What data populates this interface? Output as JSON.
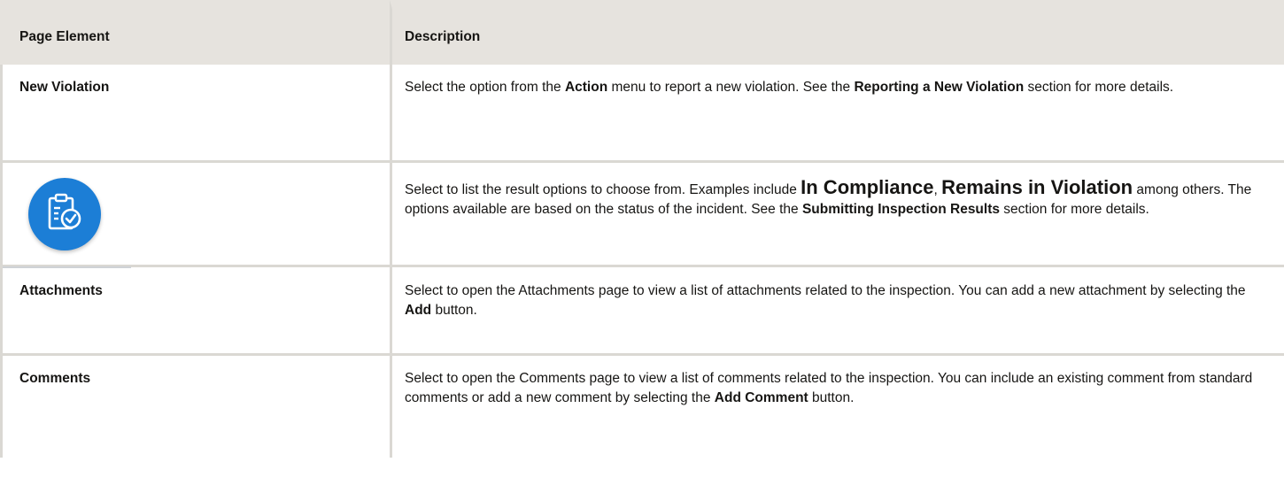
{
  "table": {
    "headers": {
      "element": "Page Element",
      "description": "Description"
    },
    "rows": {
      "new_violation": {
        "element": "New Violation",
        "desc": {
          "p1": "Select the option from the ",
          "b1": "Action",
          "p2": " menu to report a new violation. See the ",
          "b2": "Reporting a New Violation",
          "p3": " section for more details."
        }
      },
      "result": {
        "icon": "clipboard-check-icon",
        "icon_color": "#1c7ed6",
        "desc": {
          "p1": "Select to list the result options to choose from. Examples include ",
          "b1": "In Compliance",
          "p2": ", ",
          "b2": "Remains in Violation",
          "p3": " among others. The options available are based on the status of the incident. See the ",
          "b3": "Submitting Inspection Results",
          "p4": " section for more details."
        }
      },
      "attachments": {
        "element": "Attachments",
        "desc": {
          "p1": "Select to open the Attachments page to view a list of attachments related to the inspection. You can add a new attachment by selecting the ",
          "b1": "Add",
          "p2": " button."
        }
      },
      "comments": {
        "element": "Comments",
        "desc": {
          "p1": "Select to open the Comments page to view a list of comments related to the inspection. You can include an existing comment from standard comments or add a new comment by selecting the ",
          "b1": "Add Comment",
          "p2": " button."
        }
      }
    }
  }
}
